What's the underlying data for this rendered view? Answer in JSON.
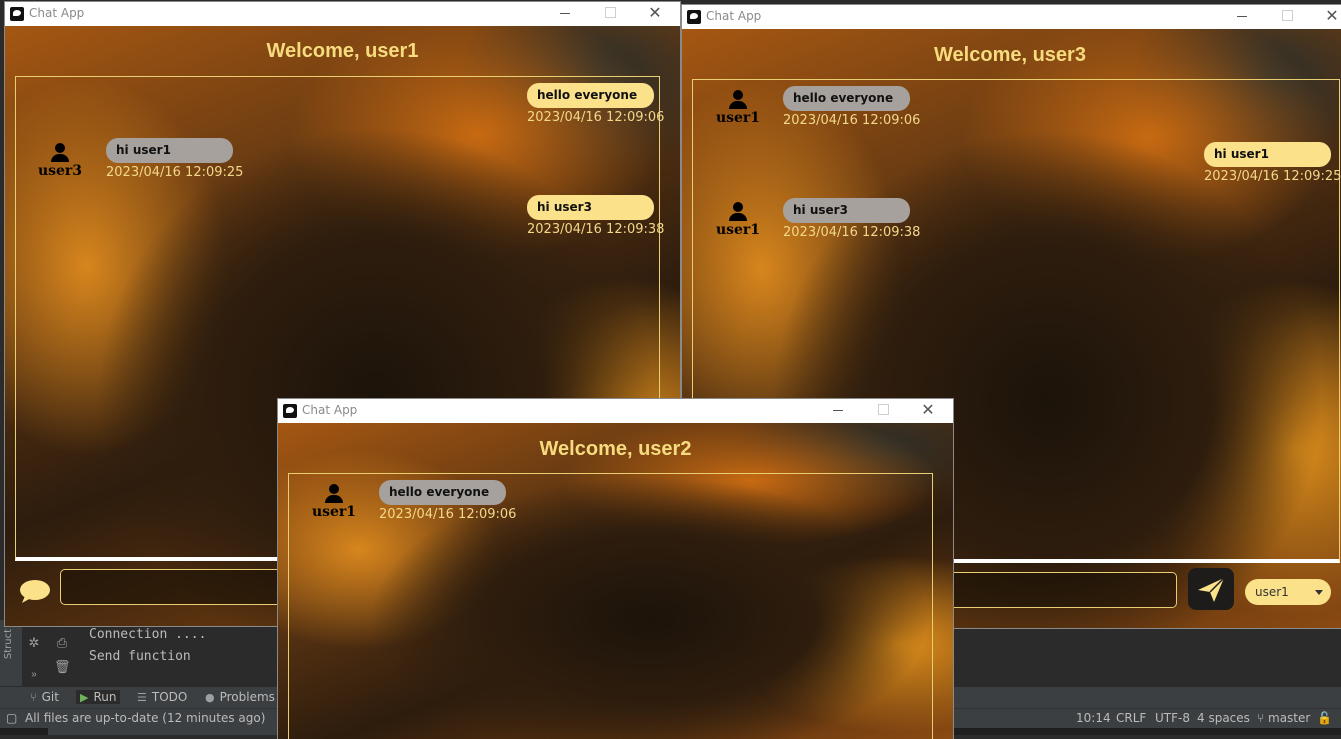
{
  "app": {
    "title": "Chat App",
    "accent": "#f6dc7e",
    "bubble_self_color": "#fbe18a",
    "bubble_other_color": "#a6a19d"
  },
  "windows": {
    "user1": {
      "welcome": "Welcome, user1",
      "messages": [
        {
          "text": "hello everyone",
          "time": "2023/04/16 12:09:06",
          "side": "self"
        },
        {
          "text": "hi user1",
          "time": "2023/04/16 12:09:25",
          "side": "other",
          "user": "user3"
        },
        {
          "text": "hi user3",
          "time": "2023/04/16 12:09:38",
          "side": "self"
        }
      ]
    },
    "user3": {
      "welcome": "Welcome, user3",
      "messages": [
        {
          "text": "hello everyone",
          "time": "2023/04/16 12:09:06",
          "side": "other",
          "user": "user1"
        },
        {
          "text": "hi user1",
          "time": "2023/04/16 12:09:25",
          "side": "self"
        },
        {
          "text": "hi user3",
          "time": "2023/04/16 12:09:38",
          "side": "other",
          "user": "user1"
        }
      ],
      "recipient_select": "user1"
    },
    "user2": {
      "welcome": "Welcome, user2",
      "messages": [
        {
          "text": "hello everyone",
          "time": "2023/04/16 12:09:06",
          "side": "other",
          "user": "user1"
        }
      ]
    }
  },
  "ide": {
    "gutter_label": "Struct",
    "console_lines": [
      "Connection ....",
      "Send function"
    ],
    "tool_windows": [
      {
        "label": "Git",
        "icon": "git-branch-icon"
      },
      {
        "label": "Run",
        "icon": "play-icon"
      },
      {
        "label": "TODO",
        "icon": "list-icon"
      },
      {
        "label": "Problems",
        "icon": "info-icon"
      }
    ],
    "status_message": "All files are up-to-date (12 minutes ago)",
    "cursor_pos": "10:14",
    "line_sep": "CRLF",
    "encoding": "UTF-8",
    "indent": "4 spaces",
    "branch": "master"
  }
}
